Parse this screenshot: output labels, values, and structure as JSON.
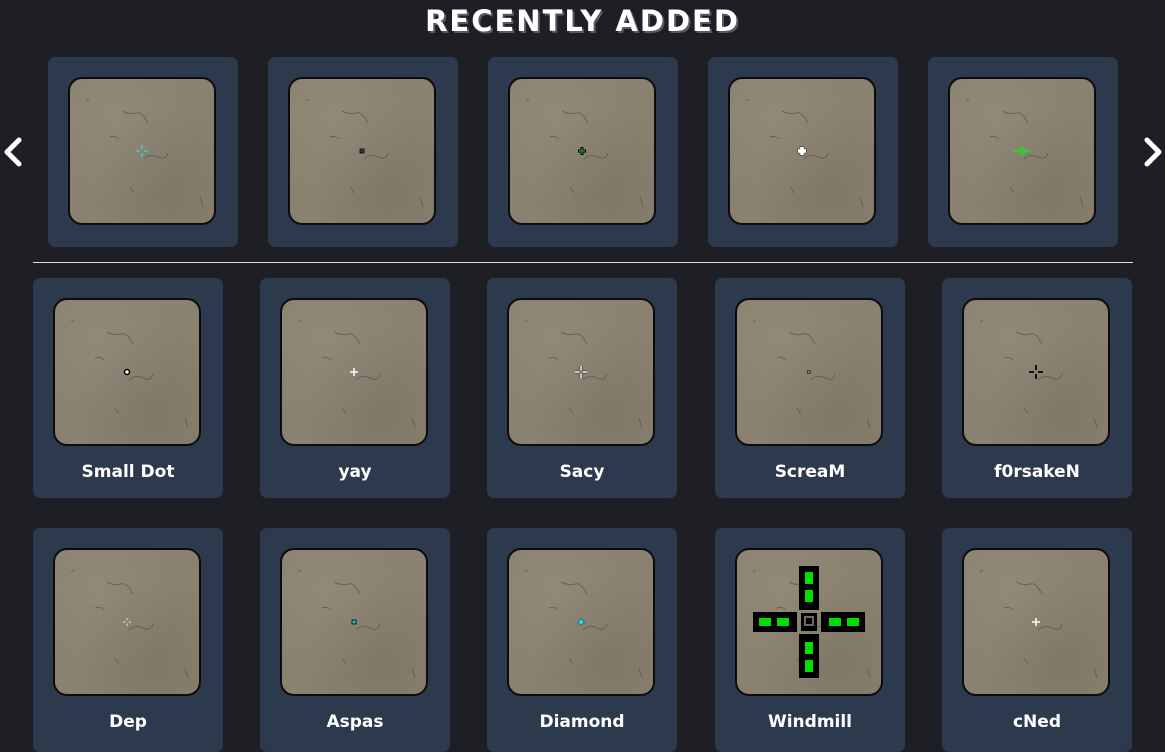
{
  "section_title": "RECENTLY ADDED",
  "carousel": {
    "prev_icon": "chevron-left-icon",
    "next_icon": "chevron-right-icon",
    "items": [
      {
        "crosshair": "cyan-cross",
        "color": "#39d0d8"
      },
      {
        "crosshair": "tiny-square",
        "color": "#2a4060"
      },
      {
        "crosshair": "green-small-cross",
        "color": "#1a8a2a"
      },
      {
        "crosshair": "white-cross-outlined",
        "color": "#ffffff"
      },
      {
        "crosshair": "green-diamond-cross",
        "color": "#1fe01f"
      }
    ]
  },
  "grid": {
    "items": [
      {
        "name": "Small Dot",
        "crosshair": "dot-ring",
        "color": "#ffffff"
      },
      {
        "name": "yay",
        "crosshair": "white-plus",
        "color": "#ffffff"
      },
      {
        "name": "Sacy",
        "crosshair": "gap-cross-outlined",
        "color": "#ffffff"
      },
      {
        "name": "ScreaM",
        "crosshair": "tiny-dot",
        "color": "#3aa060"
      },
      {
        "name": "f0rsakeN",
        "crosshair": "black-gap-cross",
        "color": "#111111"
      },
      {
        "name": "Dep",
        "crosshair": "faint-gap-cross",
        "color": "#dddddd"
      },
      {
        "name": "Aspas",
        "crosshair": "teal-square",
        "color": "#2ec0a0"
      },
      {
        "name": "Diamond",
        "crosshair": "cyan-diamond",
        "color": "#22d8e0"
      },
      {
        "name": "Windmill",
        "crosshair": "big-green-windmill",
        "color": "#00e000"
      },
      {
        "name": "cNed",
        "crosshair": "white-plus",
        "color": "#ffffff"
      }
    ]
  }
}
